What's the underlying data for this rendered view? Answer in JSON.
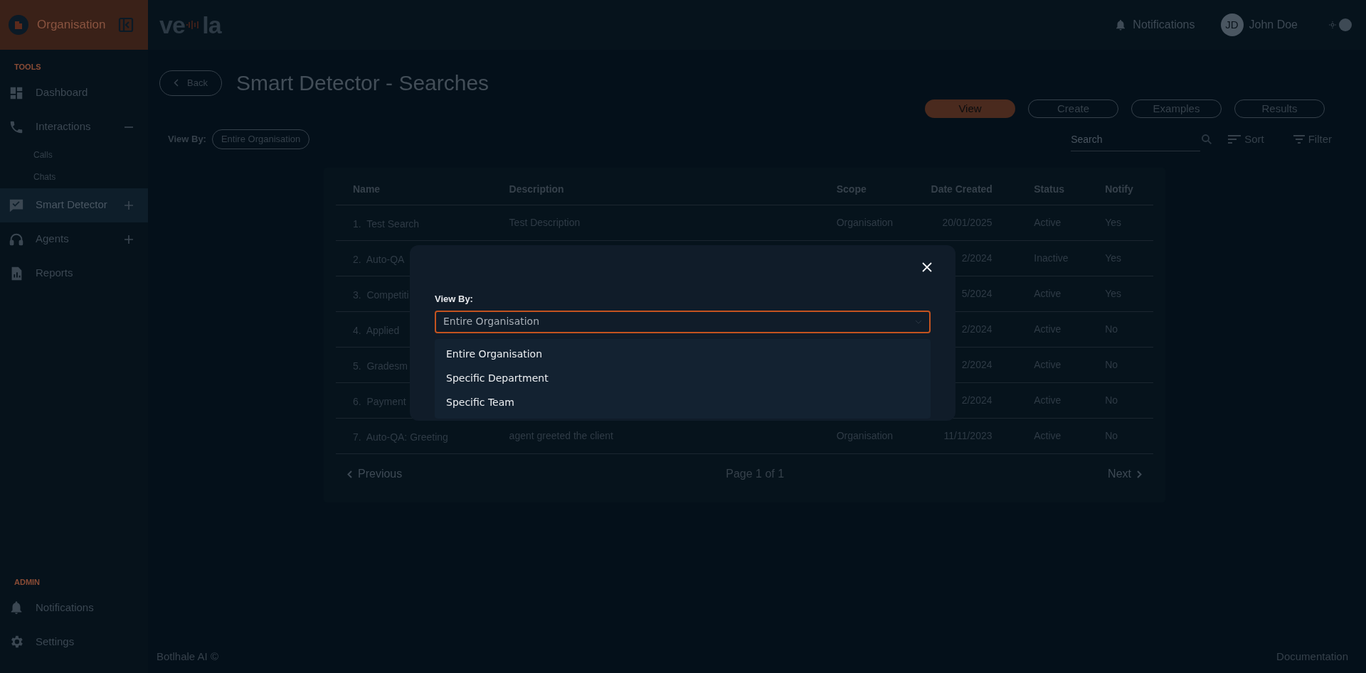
{
  "sidebar": {
    "org": "Organisation",
    "sections": [
      {
        "title": "TOOLS",
        "items": [
          {
            "label": "Dashboard",
            "selected": false
          },
          {
            "label": "Interactions",
            "selected": false,
            "expanded": true,
            "children": [
              {
                "label": "Calls"
              },
              {
                "label": "Chats"
              }
            ]
          },
          {
            "label": "Smart Detector",
            "selected": true,
            "expanded": false
          },
          {
            "label": "Agents",
            "selected": false,
            "expanded": false
          },
          {
            "label": "Reports",
            "selected": false
          }
        ]
      },
      {
        "title": "ADMIN",
        "items": [
          {
            "label": "Notifications",
            "selected": false
          },
          {
            "label": "Settings",
            "selected": false
          }
        ]
      }
    ]
  },
  "header": {
    "logo": [
      "ve",
      "la"
    ],
    "notifications": "Notifications",
    "user": {
      "initials": "JD",
      "name": "John Doe"
    }
  },
  "page": {
    "back": "Back",
    "title": "Smart Detector - Searches",
    "view_by": {
      "label": "View By:",
      "value": "Entire Organisation"
    },
    "tabs": [
      {
        "label": "View",
        "selected": true
      },
      {
        "label": "Create",
        "selected": false
      },
      {
        "label": "Examples",
        "selected": false
      },
      {
        "label": "Results",
        "selected": false
      }
    ],
    "search": {
      "placeholder": "Search"
    },
    "sort": "Sort",
    "filter": "Filter"
  },
  "table": {
    "columns": [
      "Name",
      "Description",
      "Scope",
      "Date Created",
      "Status",
      "Notify"
    ],
    "rows": [
      {
        "number": "1.",
        "name": "Test Search",
        "description": "Test Description",
        "scope": "Organisation",
        "date": "20/01/2025",
        "status": "Active",
        "notify": "Yes"
      },
      {
        "number": "2.",
        "name": "Auto-QA",
        "date": "2/2024",
        "status": "Inactive",
        "notify": "Yes"
      },
      {
        "number": "3.",
        "name": "Competiti",
        "date": "5/2024",
        "status": "Active",
        "notify": "Yes"
      },
      {
        "number": "4.",
        "name": "Applied",
        "date": "2/2024",
        "status": "Active",
        "notify": "No"
      },
      {
        "number": "5.",
        "name": "Gradesm",
        "date": "2/2024",
        "status": "Active",
        "notify": "No"
      },
      {
        "number": "6.",
        "name": "Payment",
        "date": "2/2024",
        "status": "Active",
        "notify": "No"
      },
      {
        "number": "7.",
        "name": "Auto-QA: Greeting",
        "description": "agent greeted the client",
        "scope": "Organisation",
        "date": "11/11/2023",
        "status": "Active",
        "notify": "No"
      }
    ]
  },
  "pagination": {
    "previous": "Previous",
    "page": "Page 1 of 1",
    "next": "Next"
  },
  "modal": {
    "label": "View By:",
    "value": "Entire Organisation",
    "options": [
      {
        "label": "Entire Organisation"
      },
      {
        "label": "Specific Department"
      },
      {
        "label": "Specific Team"
      }
    ]
  },
  "footer": {
    "copyright": "Botlhale AI ©",
    "documentation": "Documentation"
  }
}
